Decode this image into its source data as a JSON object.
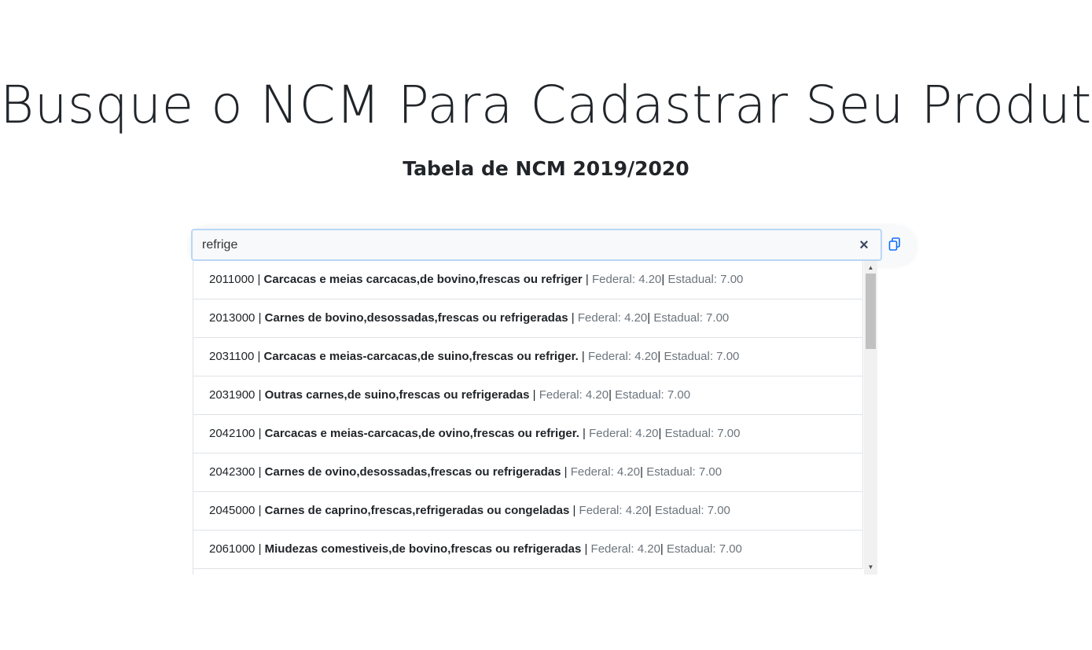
{
  "header": {
    "title": "Busque o NCM Para Cadastrar Seu Produto",
    "subtitle": "Tabela de NCM 2019/2020"
  },
  "search": {
    "value": "refrige",
    "clear_icon": "close-icon",
    "copy_icon": "copy-icon"
  },
  "results": [
    {
      "code": "2011000",
      "description": "Carcacas e meias carcacas,de bovino,frescas ou refriger",
      "federal": "Federal: 4.20",
      "estadual": "Estadual: 7.00"
    },
    {
      "code": "2013000",
      "description": "Carnes de bovino,desossadas,frescas ou refrigeradas",
      "federal": "Federal: 4.20",
      "estadual": "Estadual: 7.00"
    },
    {
      "code": "2031100",
      "description": "Carcacas e meias-carcacas,de suino,frescas ou refriger.",
      "federal": "Federal: 4.20",
      "estadual": "Estadual: 7.00"
    },
    {
      "code": "2031900",
      "description": "Outras carnes,de suino,frescas ou refrigeradas",
      "federal": "Federal: 4.20",
      "estadual": "Estadual: 7.00"
    },
    {
      "code": "2042100",
      "description": "Carcacas e meias-carcacas,de ovino,frescas ou refriger.",
      "federal": "Federal: 4.20",
      "estadual": "Estadual: 7.00"
    },
    {
      "code": "2042300",
      "description": "Carnes de ovino,desossadas,frescas ou refrigeradas",
      "federal": "Federal: 4.20",
      "estadual": "Estadual: 7.00"
    },
    {
      "code": "2045000",
      "description": "Carnes de caprino,frescas,refrigeradas ou congeladas",
      "federal": "Federal: 4.20",
      "estadual": "Estadual: 7.00"
    },
    {
      "code": "2061000",
      "description": "Miudezas comestiveis,de bovino,frescas ou refrigeradas",
      "federal": "Federal: 4.20",
      "estadual": "Estadual: 7.00"
    }
  ],
  "colors": {
    "input_border": "#b9d6f7",
    "copy_icon": "#0d6efd",
    "muted_text": "#6c757d"
  }
}
